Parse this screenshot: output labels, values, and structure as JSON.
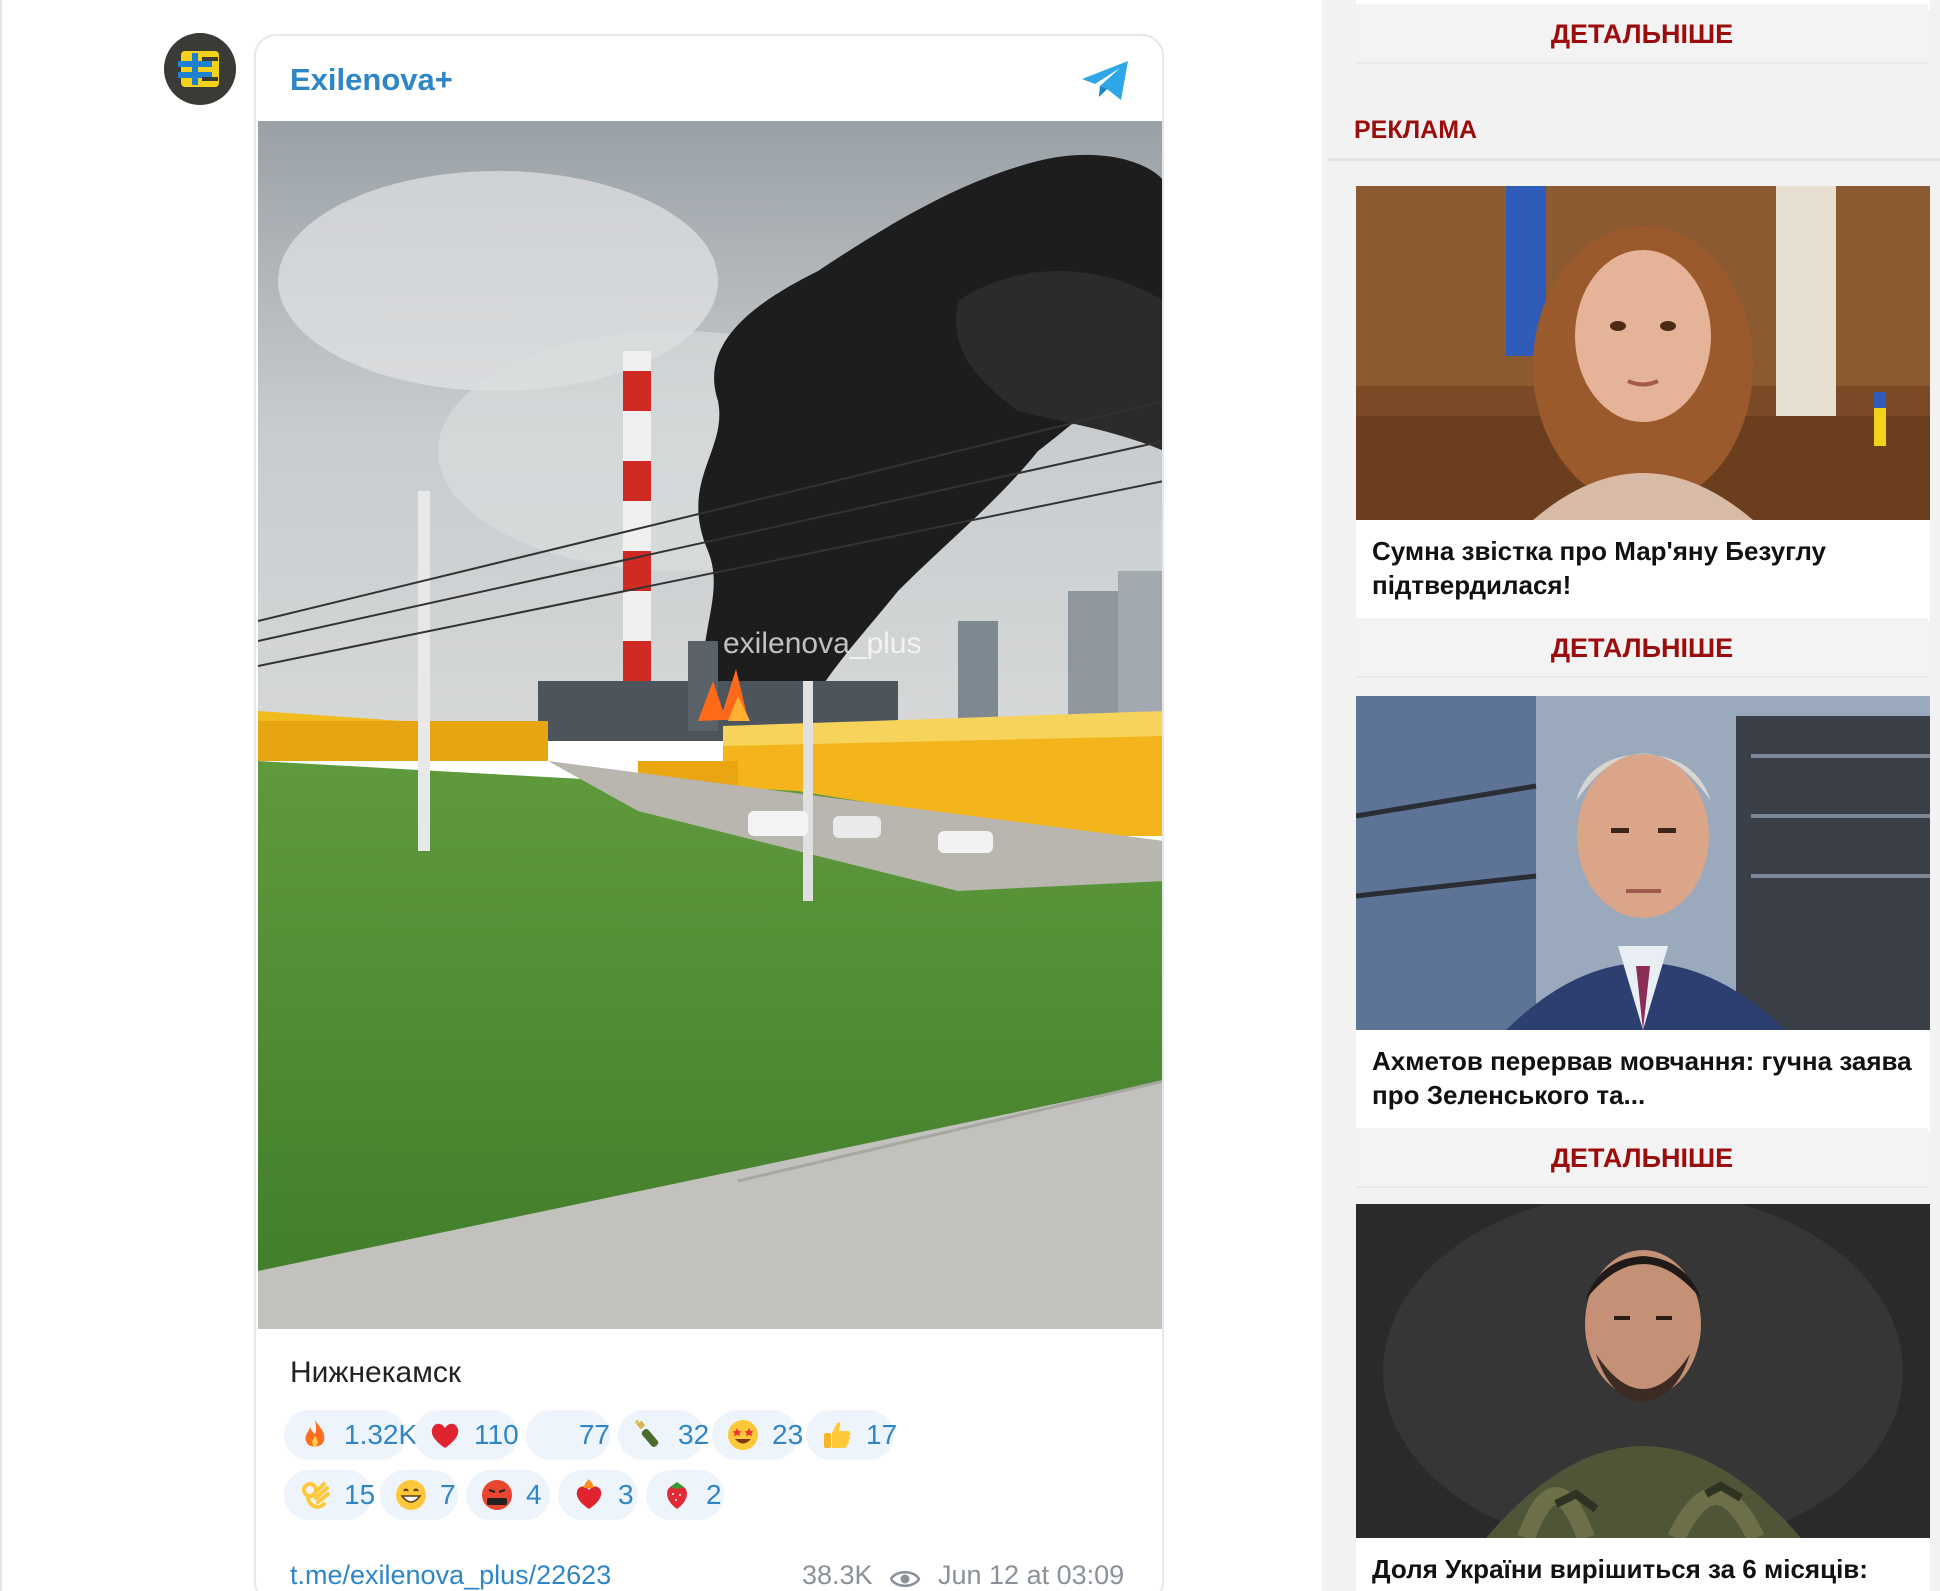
{
  "article": {
    "top_fragment": "...",
    "telegram_post": {
      "channel_name": "Exilenova+",
      "photo_watermark": "exilenova_plus",
      "caption": "Нижнекамск",
      "reactions": [
        {
          "icon": "fire-icon",
          "count": "1.32K"
        },
        {
          "icon": "red-heart-icon",
          "count": "110"
        },
        {
          "icon": "blank-reaction-icon",
          "count": "77"
        },
        {
          "icon": "champagne-icon",
          "count": "32"
        },
        {
          "icon": "star-struck-icon",
          "count": "23"
        },
        {
          "icon": "thumbs-up-icon",
          "count": "17"
        },
        {
          "icon": "ok-hand-icon",
          "count": "15"
        },
        {
          "icon": "grinning-face-icon",
          "count": "7"
        },
        {
          "icon": "cursing-face-icon",
          "count": "4"
        },
        {
          "icon": "heart-on-fire-icon",
          "count": "3"
        },
        {
          "icon": "strawberry-icon",
          "count": "2"
        }
      ],
      "post_link": "t.me/exilenova_plus/22623",
      "views": "38.3K",
      "date": "Jun 12 at 03:09"
    }
  },
  "sidebar": {
    "more_label": "ДЕТАЛЬНІШЕ",
    "ad_section_label": "РЕКЛАМА",
    "ads": [
      {
        "title": "Сумна звістка про Мар'яну Безуглу підтвердилася!",
        "more_label": "ДЕТАЛЬНІШЕ"
      },
      {
        "title": "Ахметов перервав мовчання: гучна заява про Зеленського та...",
        "more_label": "ДЕТАЛЬНІШЕ"
      },
      {
        "title": "Доля України вирішиться за 6 місяців:",
        "more_label": ""
      }
    ]
  },
  "colors": {
    "telegram_blue": "#2f86c7",
    "reaction_bg": "#eef4fb",
    "sidebar_accent": "#9b0d0d"
  }
}
